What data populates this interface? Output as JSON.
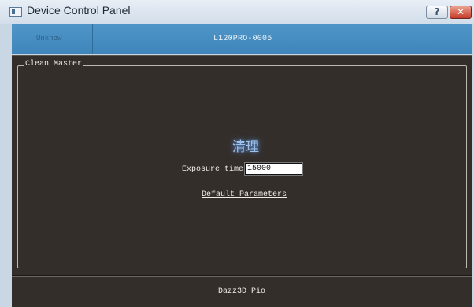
{
  "window": {
    "title": "Device Control Panel",
    "help_label": "?",
    "close_label": "✕"
  },
  "device_bar": {
    "left_label": "Unknow",
    "center_label": "L120PRO-0005"
  },
  "clean_master": {
    "group_title": "Clean Master",
    "clean_button_label": "清理",
    "exposure_label": "Exposure time",
    "exposure_value": "15000",
    "default_parameters_label": "Default Parameters"
  },
  "footer": {
    "label": "Dazz3D Pio"
  },
  "colors": {
    "title_bar": "#d2deea",
    "device_bar": "#3f86bb",
    "panel_background": "#342e2b",
    "clean_button_glow": "#9cc2eb"
  },
  "icons": {
    "app_icon": "window-icon",
    "help": "question-mark-icon",
    "close": "close-icon"
  }
}
